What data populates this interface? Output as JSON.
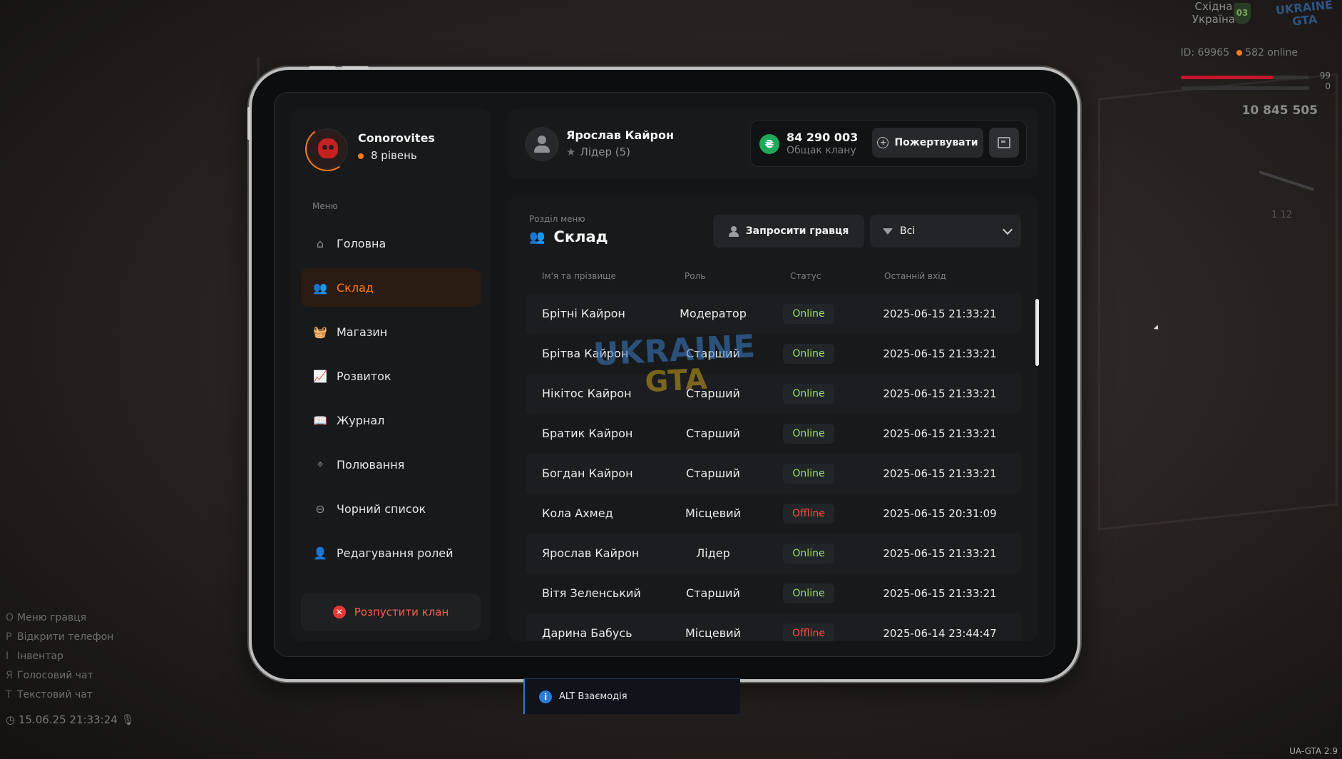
{
  "hud": {
    "region_line1": "Східна",
    "region_line2": "Україна",
    "region_badge": "03",
    "logo_line1": "UKRAINE",
    "logo_line2": "GTA",
    "player_id": "ID: 69965",
    "online": "582 online",
    "health_value": "99",
    "armor_value": "0",
    "money": "10 845 505",
    "ammo": "1  12",
    "hotkeys": [
      {
        "key": "O",
        "label": "Меню гравця"
      },
      {
        "key": "P",
        "label": "Відкрити телефон"
      },
      {
        "key": "I",
        "label": "Інвентар"
      },
      {
        "key": "Я",
        "label": "Голосовий чат"
      },
      {
        "key": "T",
        "label": "Текстовий чат"
      }
    ],
    "clock": "15.06.25 21:33:24",
    "version": "UA-GTA 2.9"
  },
  "clan": {
    "name": "Conorovites",
    "level": "8 рівень",
    "menu_caption": "Меню",
    "menu": [
      {
        "label": "Головна",
        "icon": "home-icon",
        "active": false
      },
      {
        "label": "Склад",
        "icon": "members-icon",
        "active": true
      },
      {
        "label": "Магазин",
        "icon": "shop-basket-icon",
        "active": false
      },
      {
        "label": "Розвиток",
        "icon": "growth-chart-icon",
        "active": false
      },
      {
        "label": "Журнал",
        "icon": "journal-book-icon",
        "active": false
      },
      {
        "label": "Полювання",
        "icon": "crosshair-icon",
        "active": false
      },
      {
        "label": "Чорний список",
        "icon": "blocked-icon",
        "active": false
      },
      {
        "label": "Редагування ролей",
        "icon": "edit-user-icon",
        "active": false
      }
    ],
    "disband_label": "Розпустити клан"
  },
  "user": {
    "name": "Ярослав Кайрон",
    "role": "Лідер (5)"
  },
  "bank": {
    "amount": "84 290 003",
    "label": "Общак клану",
    "currency_symbol": "₴",
    "donate_label": "Пожертвувати"
  },
  "section": {
    "caption": "Розділ меню",
    "title": "Склад",
    "invite_label": "Запросити гравця",
    "filter_value": "Всі"
  },
  "table": {
    "columns": [
      "Ім'я та прізвище",
      "Роль",
      "Статус",
      "Останній вхід"
    ],
    "rows": [
      {
        "name": "Брітні Кайрон",
        "role": "Модератор",
        "status": "Online",
        "last": "2025-06-15 21:33:21"
      },
      {
        "name": "Брітва Кайрон",
        "role": "Старший",
        "status": "Online",
        "last": "2025-06-15 21:33:21"
      },
      {
        "name": "Нікітос Кайрон",
        "role": "Старший",
        "status": "Online",
        "last": "2025-06-15 21:33:21"
      },
      {
        "name": "Братик Кайрон",
        "role": "Старший",
        "status": "Online",
        "last": "2025-06-15 21:33:21"
      },
      {
        "name": "Богдан Кайрон",
        "role": "Старший",
        "status": "Online",
        "last": "2025-06-15 21:33:21"
      },
      {
        "name": "Кола Ахмед",
        "role": "Місцевий",
        "status": "Offline",
        "last": "2025-06-15 20:31:09"
      },
      {
        "name": "Ярослав Кайрон",
        "role": "Лідер",
        "status": "Online",
        "last": "2025-06-15 21:33:21"
      },
      {
        "name": "Вітя Зеленський",
        "role": "Старший",
        "status": "Online",
        "last": "2025-06-15 21:33:21"
      },
      {
        "name": "Дарина Бабусь",
        "role": "Місцевий",
        "status": "Offline",
        "last": "2025-06-14 23:44:47"
      }
    ]
  },
  "watermark": {
    "line1": "UKRAINE",
    "line2": "GTA"
  },
  "hint": {
    "label": "ALT Взаємодія"
  },
  "colors": {
    "accent": "#ff7a1a",
    "online": "#9be15d",
    "offline": "#ff4d3d",
    "bank": "#1fa85a",
    "danger": "#e53935"
  }
}
